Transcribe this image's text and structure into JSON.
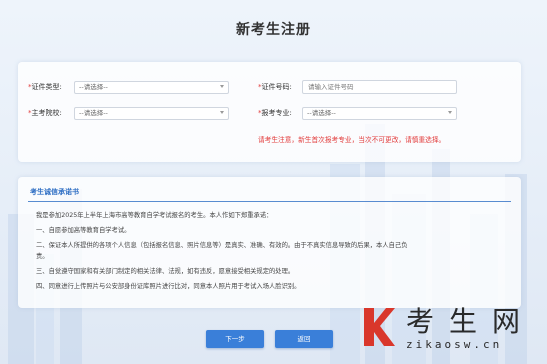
{
  "page": {
    "title": "新考生注册"
  },
  "form": {
    "id_type": {
      "label": "证件类型:",
      "value": "--请选择--"
    },
    "id_number": {
      "label": "证件号码:",
      "placeholder": "请输入证件号码"
    },
    "school": {
      "label": "主考院校:",
      "value": "--请选择--"
    },
    "major": {
      "label": "报考专业:",
      "value": "--请选择--"
    },
    "required_mark": "*",
    "notice": "请考生注意，新生首次报考专业，当次不可更改，请慎重选择。"
  },
  "pledge": {
    "title": "考生诚信承诺书",
    "lines": [
      "我是参加2025年上半年上海市高等教育自学考试报名的考生。本人作如下郑重承诺：",
      "一、自愿参加高等教育自学考试。",
      "二、保证本人所提供的各项个人信息（包括报名信息、照片信息等）是真实、准确、有效的。由于不真实信息导致的后果，本人自己负",
      "责。",
      "三、自觉遵守国家和有关部门制定的相关法律、法规，如有违反，愿意接受相关规定的处理。",
      "四、同意进行上传照片与公安部身份证库照片进行比对，同意本人照片用于考试入场人脸识别。"
    ]
  },
  "buttons": {
    "next": "下一步",
    "back": "返回"
  },
  "watermark": {
    "brand_cn": "考生网",
    "url": "zikaosw.cn"
  },
  "colors": {
    "accent": "#3a7fd9",
    "required": "#e23b3b",
    "pledge_title": "#2f6fc4"
  }
}
